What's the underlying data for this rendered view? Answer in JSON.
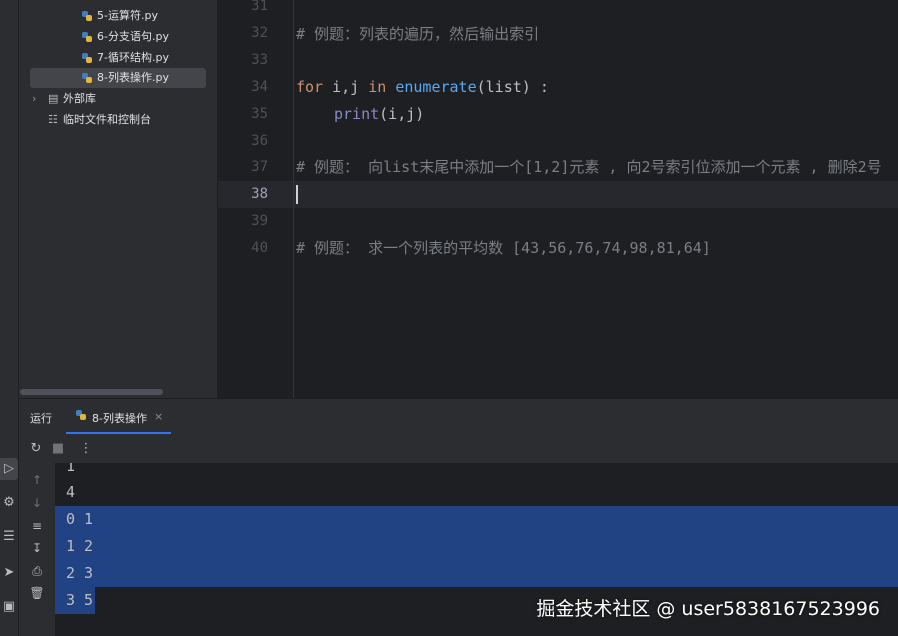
{
  "project_tree": {
    "items": [
      {
        "label": "5-运算符.py",
        "icon": "python-file-icon"
      },
      {
        "label": "6-分支语句.py",
        "icon": "python-file-icon"
      },
      {
        "label": "7-循环结构.py",
        "icon": "python-file-icon"
      },
      {
        "label": "8-列表操作.py",
        "icon": "python-file-icon",
        "selected": true
      }
    ],
    "external_libraries": "外部库",
    "scratches": "临时文件和控制台"
  },
  "editor": {
    "lines": [
      {
        "num": "31"
      },
      {
        "num": "32"
      },
      {
        "num": "33"
      },
      {
        "num": "34"
      },
      {
        "num": "35"
      },
      {
        "num": "36"
      },
      {
        "num": "37"
      },
      {
        "num": "38"
      },
      {
        "num": "39"
      },
      {
        "num": "40"
      }
    ],
    "code": {
      "line32": "# 例题：列表的遍历，然后输出索引",
      "line34_for": "for",
      "line34_vars": " i,j ",
      "line34_in": "in",
      "line34_enum": "enumerate",
      "line34_rest": "(list) :",
      "line35_print": "print",
      "line35_rest": "(i,j)",
      "line37": "# 例题： 向list末尾中添加一个[1,2]元素 , 向2号索引位添加一个元素 , 删除2号",
      "line40": "# 例题： 求一个列表的平均数 [43,56,76,74,98,81,64]"
    },
    "current_line": "38"
  },
  "run_panel": {
    "title": "运行",
    "tab_label": "8-列表操作",
    "output": [
      {
        "text": "1",
        "selected": false
      },
      {
        "text": "4",
        "selected": false
      },
      {
        "text": "0 1",
        "selected": true
      },
      {
        "text": "1 2",
        "selected": true
      },
      {
        "text": "2 3",
        "selected": true
      },
      {
        "text": "3 5",
        "selected": true
      }
    ]
  },
  "watermark": "掘金技术社区 @ user5838167523996",
  "colors": {
    "selection": "#214283",
    "keyword": "#cf8e6d",
    "function": "#56a8f5",
    "builtin": "#8888c6",
    "comment": "#7a7e85",
    "accent": "#3574f0"
  }
}
